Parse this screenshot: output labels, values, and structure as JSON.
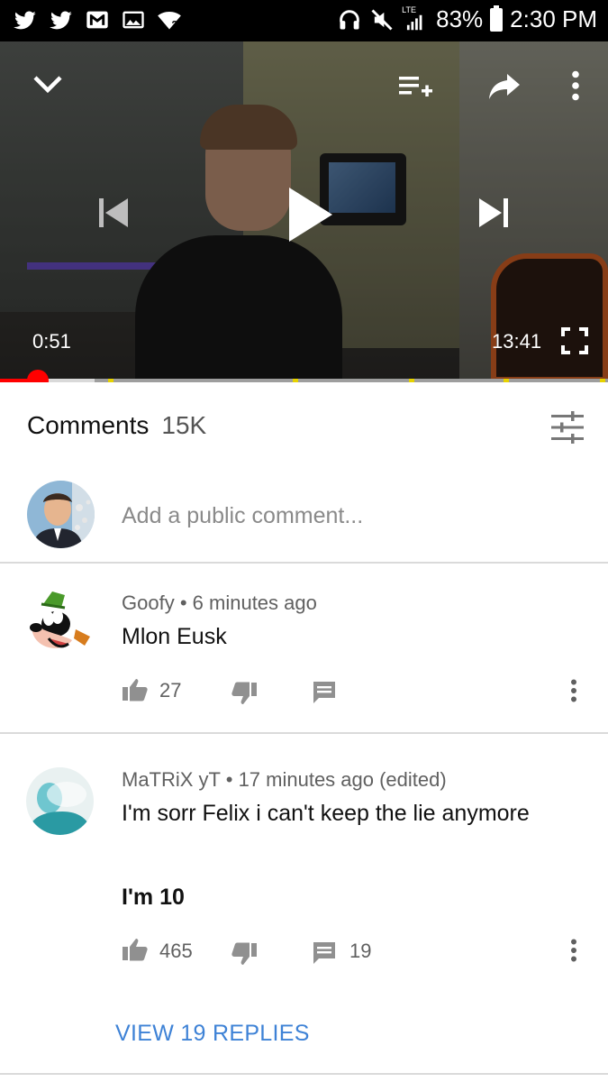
{
  "status_bar": {
    "lte_label": "LTE",
    "battery_percent": "83%",
    "time": "2:30 PM",
    "icons": [
      "twitter-icon",
      "twitter-icon",
      "gmail-icon",
      "gallery-icon",
      "wifi-icon",
      "headset-icon",
      "mute-icon",
      "signal-icon",
      "battery-icon"
    ]
  },
  "player": {
    "current_time": "0:51",
    "duration": "13:41",
    "progress_fraction": 0.062,
    "buffer_fraction": 0.155,
    "icons": {
      "minimize": "chevron-down-icon",
      "add_to_playlist": "playlist-add-icon",
      "share": "share-icon",
      "more": "more-vert-icon",
      "previous": "skip-previous-icon",
      "play": "play-icon",
      "next": "skip-next-icon",
      "fullscreen": "fullscreen-icon"
    }
  },
  "comments": {
    "title": "Comments",
    "count": "15K",
    "add_placeholder": "Add a public comment...",
    "items": [
      {
        "author": "Goofy",
        "time": "6 minutes ago",
        "text": "Mlon Eusk",
        "likes": "27",
        "replies_count": ""
      },
      {
        "author": "MaTRiX yT",
        "time": "17 minutes ago (edited)",
        "text": "I'm sorr Felix i can't keep the lie anymore",
        "text_bold": "I'm 10",
        "likes": "465",
        "replies_count": "19"
      }
    ],
    "view_replies_label": "VIEW 19 REPLIES"
  },
  "colors": {
    "accent_red": "#ff0000",
    "link_blue": "#3e82d6",
    "status_bar_bg": "#000000"
  }
}
